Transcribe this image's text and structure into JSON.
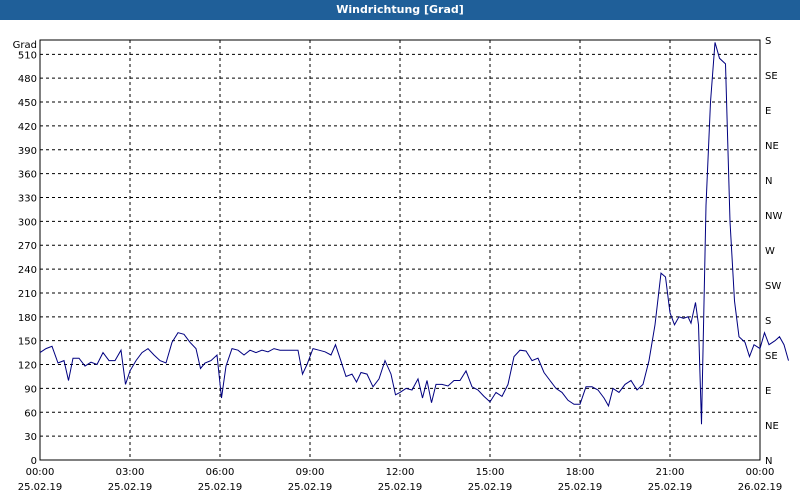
{
  "window": {
    "title": "Windrichtung [Grad]"
  },
  "chart_data": {
    "type": "line",
    "ylabel": "Grad",
    "ylim": [
      0,
      528
    ],
    "y_ticks": [
      0,
      30,
      60,
      90,
      120,
      150,
      180,
      210,
      240,
      270,
      300,
      330,
      360,
      390,
      420,
      450,
      480,
      510
    ],
    "right_axis": [
      {
        "value": 0,
        "label": "N"
      },
      {
        "value": 45,
        "label": "NE"
      },
      {
        "value": 90,
        "label": "E"
      },
      {
        "value": 135,
        "label": "SE"
      },
      {
        "value": 180,
        "label": "S"
      },
      {
        "value": 225,
        "label": "SW"
      },
      {
        "value": 270,
        "label": "W"
      },
      {
        "value": 315,
        "label": "NW"
      },
      {
        "value": 360,
        "label": "N"
      },
      {
        "value": 405,
        "label": "NE"
      },
      {
        "value": 450,
        "label": "E"
      },
      {
        "value": 495,
        "label": "SE"
      },
      {
        "value": 540,
        "label": "S"
      }
    ],
    "xlim": [
      0,
      24
    ],
    "x_ticks": [
      {
        "hour": 0,
        "time": "00:00",
        "date": "25.02.19"
      },
      {
        "hour": 3,
        "time": "03:00",
        "date": "25.02.19"
      },
      {
        "hour": 6,
        "time": "06:00",
        "date": "25.02.19"
      },
      {
        "hour": 9,
        "time": "09:00",
        "date": "25.02.19"
      },
      {
        "hour": 12,
        "time": "12:00",
        "date": "25.02.19"
      },
      {
        "hour": 15,
        "time": "15:00",
        "date": "25.02.19"
      },
      {
        "hour": 18,
        "time": "18:00",
        "date": "25.02.19"
      },
      {
        "hour": 21,
        "time": "21:00",
        "date": "25.02.19"
      },
      {
        "hour": 24,
        "time": "00:00",
        "date": "26.02.19"
      }
    ],
    "grid": true,
    "series": [
      {
        "color": "#000080",
        "points": [
          [
            0.0,
            135
          ],
          [
            0.2,
            140
          ],
          [
            0.4,
            143
          ],
          [
            0.6,
            122
          ],
          [
            0.8,
            125
          ],
          [
            0.95,
            100
          ],
          [
            1.1,
            128
          ],
          [
            1.3,
            128
          ],
          [
            1.5,
            118
          ],
          [
            1.7,
            123
          ],
          [
            1.9,
            120
          ],
          [
            2.1,
            135
          ],
          [
            2.3,
            125
          ],
          [
            2.5,
            125
          ],
          [
            2.7,
            138
          ],
          [
            2.85,
            95
          ],
          [
            3.0,
            112
          ],
          [
            3.2,
            125
          ],
          [
            3.4,
            135
          ],
          [
            3.6,
            140
          ],
          [
            3.8,
            132
          ],
          [
            4.0,
            125
          ],
          [
            4.2,
            122
          ],
          [
            4.4,
            148
          ],
          [
            4.6,
            160
          ],
          [
            4.8,
            158
          ],
          [
            5.0,
            148
          ],
          [
            5.2,
            140
          ],
          [
            5.35,
            115
          ],
          [
            5.5,
            122
          ],
          [
            5.7,
            125
          ],
          [
            5.9,
            132
          ],
          [
            6.05,
            78
          ],
          [
            6.2,
            118
          ],
          [
            6.4,
            140
          ],
          [
            6.6,
            138
          ],
          [
            6.8,
            132
          ],
          [
            7.0,
            138
          ],
          [
            7.2,
            135
          ],
          [
            7.4,
            138
          ],
          [
            7.6,
            136
          ],
          [
            7.8,
            140
          ],
          [
            8.0,
            138
          ],
          [
            8.2,
            138
          ],
          [
            8.4,
            138
          ],
          [
            8.6,
            138
          ],
          [
            8.75,
            108
          ],
          [
            8.9,
            120
          ],
          [
            9.1,
            140
          ],
          [
            9.3,
            138
          ],
          [
            9.5,
            136
          ],
          [
            9.7,
            132
          ],
          [
            9.85,
            145
          ],
          [
            10.0,
            128
          ],
          [
            10.2,
            105
          ],
          [
            10.4,
            108
          ],
          [
            10.55,
            98
          ],
          [
            10.7,
            110
          ],
          [
            10.9,
            108
          ],
          [
            11.1,
            92
          ],
          [
            11.3,
            102
          ],
          [
            11.5,
            125
          ],
          [
            11.7,
            108
          ],
          [
            11.85,
            82
          ],
          [
            12.0,
            85
          ],
          [
            12.2,
            90
          ],
          [
            12.4,
            88
          ],
          [
            12.6,
            102
          ],
          [
            12.75,
            78
          ],
          [
            12.9,
            100
          ],
          [
            13.05,
            72
          ],
          [
            13.2,
            95
          ],
          [
            13.4,
            95
          ],
          [
            13.6,
            93
          ],
          [
            13.8,
            100
          ],
          [
            14.0,
            100
          ],
          [
            14.2,
            112
          ],
          [
            14.4,
            92
          ],
          [
            14.6,
            88
          ],
          [
            14.8,
            80
          ],
          [
            15.0,
            73
          ],
          [
            15.2,
            85
          ],
          [
            15.4,
            80
          ],
          [
            15.6,
            95
          ],
          [
            15.8,
            130
          ],
          [
            16.0,
            138
          ],
          [
            16.2,
            137
          ],
          [
            16.4,
            125
          ],
          [
            16.6,
            128
          ],
          [
            16.8,
            110
          ],
          [
            17.0,
            100
          ],
          [
            17.2,
            90
          ],
          [
            17.4,
            85
          ],
          [
            17.6,
            75
          ],
          [
            17.8,
            70
          ],
          [
            18.0,
            70
          ],
          [
            18.2,
            92
          ],
          [
            18.4,
            92
          ],
          [
            18.6,
            88
          ],
          [
            18.8,
            78
          ],
          [
            18.95,
            68
          ],
          [
            19.1,
            90
          ],
          [
            19.3,
            85
          ],
          [
            19.5,
            95
          ],
          [
            19.7,
            100
          ],
          [
            19.9,
            88
          ],
          [
            20.1,
            95
          ],
          [
            20.3,
            125
          ],
          [
            20.5,
            170
          ],
          [
            20.7,
            235
          ],
          [
            20.85,
            230
          ],
          [
            21.0,
            185
          ],
          [
            21.15,
            170
          ],
          [
            21.3,
            180
          ],
          [
            21.45,
            178
          ],
          [
            21.6,
            180
          ],
          [
            21.7,
            172
          ],
          [
            21.85,
            198
          ],
          [
            21.95,
            170
          ],
          [
            22.05,
            45
          ],
          [
            22.2,
            320
          ],
          [
            22.35,
            450
          ],
          [
            22.5,
            525
          ],
          [
            22.65,
            505
          ],
          [
            22.85,
            498
          ],
          [
            23.0,
            300
          ],
          [
            23.15,
            200
          ],
          [
            23.3,
            155
          ],
          [
            23.5,
            148
          ],
          [
            23.65,
            130
          ],
          [
            23.8,
            145
          ],
          [
            24.0,
            140
          ],
          [
            24.15,
            160
          ],
          [
            24.3,
            145
          ],
          [
            24.5,
            150
          ],
          [
            24.65,
            155
          ],
          [
            24.8,
            145
          ],
          [
            24.95,
            125
          ]
        ]
      }
    ]
  }
}
